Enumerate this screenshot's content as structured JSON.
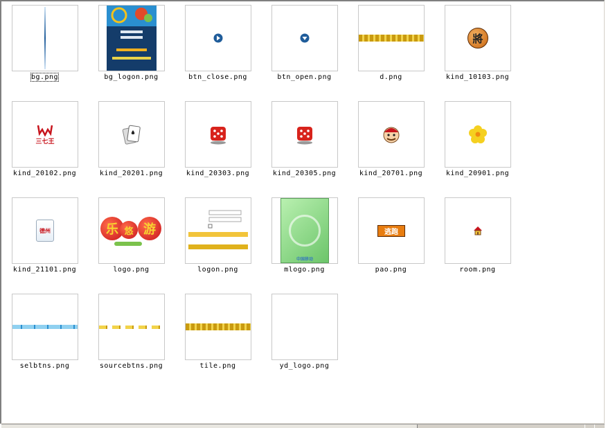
{
  "files": [
    {
      "name": "bg.png",
      "icon": "blue-line-icon"
    },
    {
      "name": "bg_logon.png",
      "icon": "logon-background-thumbnail"
    },
    {
      "name": "btn_close.png",
      "icon": "circle-arrow-right-icon"
    },
    {
      "name": "btn_open.png",
      "icon": "circle-arrow-down-icon"
    },
    {
      "name": "d.png",
      "icon": "banner-text-thumbnail"
    },
    {
      "name": "kind_10103.png",
      "icon": "chess-piece-icon"
    },
    {
      "name": "kind_20102.png",
      "icon": "trident-logo-icon"
    },
    {
      "name": "kind_20201.png",
      "icon": "playing-cards-icon"
    },
    {
      "name": "kind_20303.png",
      "icon": "dice-icon"
    },
    {
      "name": "kind_20305.png",
      "icon": "dice-icon"
    },
    {
      "name": "kind_20701.png",
      "icon": "character-face-icon"
    },
    {
      "name": "kind_20901.png",
      "icon": "yellow-flower-icon"
    },
    {
      "name": "kind_21101.png",
      "icon": "card-icon"
    },
    {
      "name": "logo.png",
      "icon": "logo-thumbnail"
    },
    {
      "name": "logon.png",
      "icon": "logon-form-thumbnail"
    },
    {
      "name": "mlogo.png",
      "icon": "green-logo-thumbnail"
    },
    {
      "name": "pao.png",
      "icon": "run-button-icon"
    },
    {
      "name": "room.png",
      "icon": "house-icon"
    },
    {
      "name": "selbtns.png",
      "icon": "button-strip-thumbnail"
    },
    {
      "name": "sourcebtns.png",
      "icon": "button-strip-thumbnail"
    },
    {
      "name": "tile.png",
      "icon": "banner-text-thumbnail"
    },
    {
      "name": "yd_logo.png",
      "icon": "blank-thumbnail"
    }
  ],
  "thumb_text": {
    "kind_10103": "將",
    "kind_20102": "三七王",
    "kind_21101": "德州",
    "logo": [
      "乐",
      "悠",
      "游"
    ],
    "pao": "逃跑",
    "mlogo_caption": "中国移动"
  },
  "colors": {
    "thumb_border": "#c8c8c8",
    "blue_accent": "#1f5c9a",
    "orange": "#e87d10",
    "red": "#d8231c",
    "green": "#8fd88a"
  }
}
